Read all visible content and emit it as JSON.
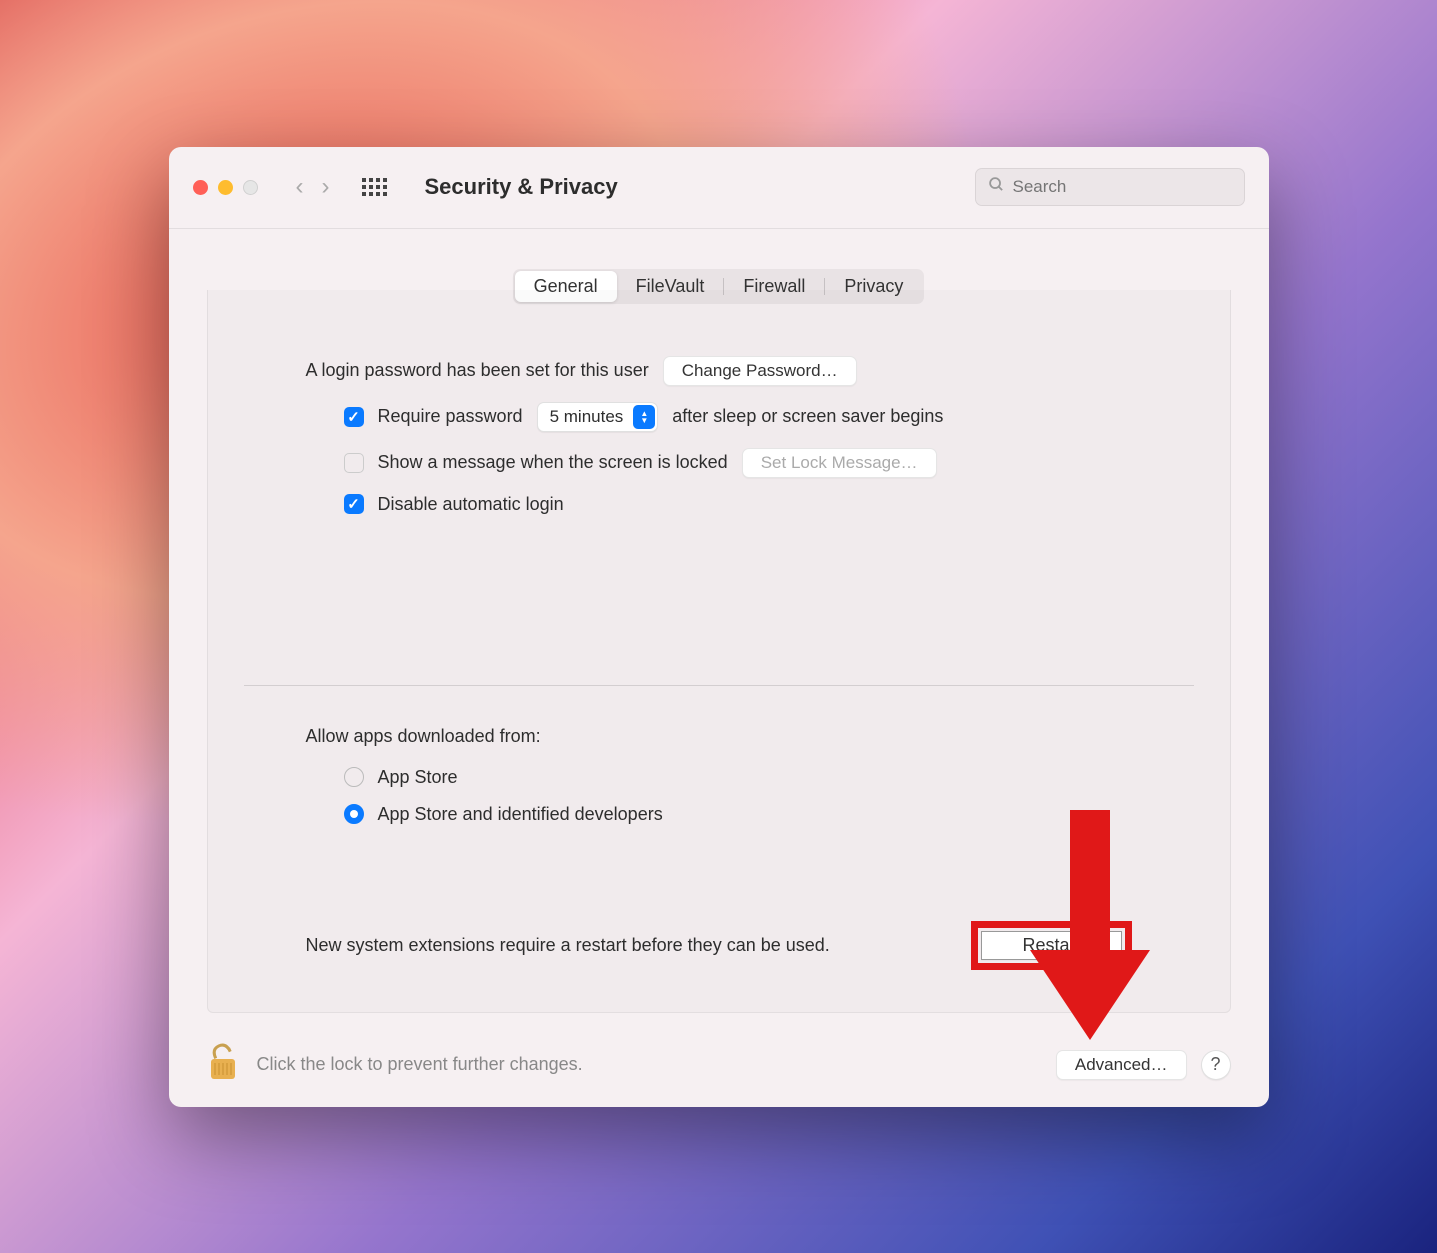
{
  "window": {
    "title": "Security & Privacy",
    "search_placeholder": "Search"
  },
  "tabs": [
    "General",
    "FileVault",
    "Firewall",
    "Privacy"
  ],
  "active_tab": "General",
  "general": {
    "login_password_text": "A login password has been set for this user",
    "change_password_btn": "Change Password…",
    "require_password_label": "Require password",
    "require_password_checked": true,
    "delay_value": "5 minutes",
    "after_sleep_text": "after sleep or screen saver begins",
    "show_message_label": "Show a message when the screen is locked",
    "show_message_checked": false,
    "set_lock_message_btn": "Set Lock Message…",
    "disable_auto_login_label": "Disable automatic login",
    "disable_auto_login_checked": true,
    "allow_apps_label": "Allow apps downloaded from:",
    "allow_options": {
      "app_store": "App Store",
      "identified": "App Store and identified developers"
    },
    "allow_selected": "identified",
    "restart_text": "New system extensions require a restart before they can be used.",
    "restart_btn": "Restart"
  },
  "footer": {
    "lock_text": "Click the lock to prevent further changes.",
    "advanced_btn": "Advanced…",
    "help": "?"
  },
  "annotation": {
    "arrow_color": "#e01818"
  }
}
